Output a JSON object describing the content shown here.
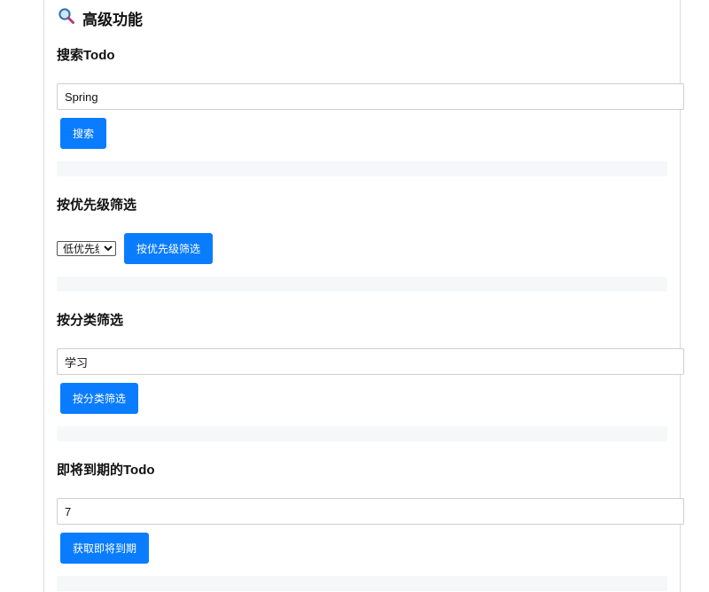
{
  "section": {
    "title": "高级功能",
    "icon": "magnifier-icon"
  },
  "search": {
    "heading": "搜索Todo",
    "input_value": "Spring",
    "button_label": "搜索"
  },
  "priority_filter": {
    "heading": "按优先级筛选",
    "selected": "低优先级",
    "options": [
      "低优先级"
    ],
    "button_label": "按优先级筛选"
  },
  "category_filter": {
    "heading": "按分类筛选",
    "input_value": "学习",
    "button_label": "按分类筛选"
  },
  "due_soon": {
    "heading": "即将到期的Todo",
    "input_value": "7",
    "button_label": "获取即将到期"
  },
  "colors": {
    "accent": "#0a7cff",
    "result_bg": "#f6f7f9"
  }
}
